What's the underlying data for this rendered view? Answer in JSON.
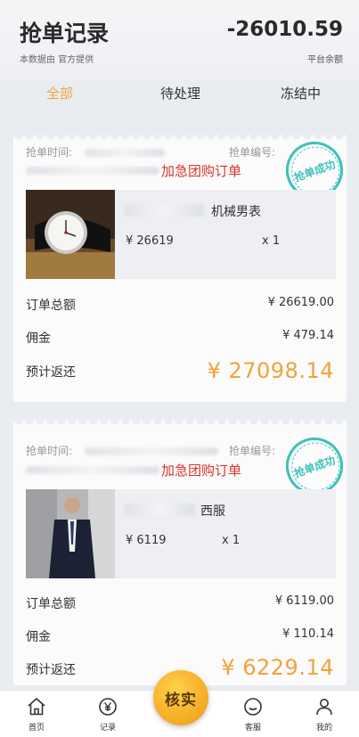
{
  "header": {
    "title": "抢单记录",
    "subtitle": "本数据由        官方提供",
    "balance": "-26010.59",
    "balance_label": "平台余额"
  },
  "tabs": [
    "全部",
    "待处理",
    "冻结中"
  ],
  "orders": [
    {
      "time_label": "抢单时间:",
      "number_label": "抢单编号:",
      "urgent_text": "加急团购订单",
      "stamp_text": "抢单成功",
      "product_name": "机械男表",
      "product_price": "¥ 26619",
      "product_qty": "x 1",
      "total_label": "订单总额",
      "total_value": "¥ 26619.00",
      "commission_label": "佣金",
      "commission_value": "¥ 479.14",
      "return_label": "预计返还",
      "return_value": "¥ 27098.14"
    },
    {
      "time_label": "抢单时间:",
      "number_label": "抢单编号:",
      "urgent_text": "加急团购订单",
      "stamp_text": "抢单成功",
      "product_name": "西服",
      "product_price": "¥ 6119",
      "product_qty": "x 1",
      "total_label": "订单总额",
      "total_value": "¥ 6119.00",
      "commission_label": "佣金",
      "commission_value": "¥ 110.14",
      "return_label": "预计返还",
      "return_value": "¥ 6229.14"
    }
  ],
  "nav": {
    "home": "首页",
    "records": "记录",
    "verify": "核实",
    "service": "客服",
    "mine": "我的"
  },
  "colors": {
    "accent": "#f2a23a",
    "urgent": "#d8352a",
    "stamp": "#3ec1b9"
  }
}
